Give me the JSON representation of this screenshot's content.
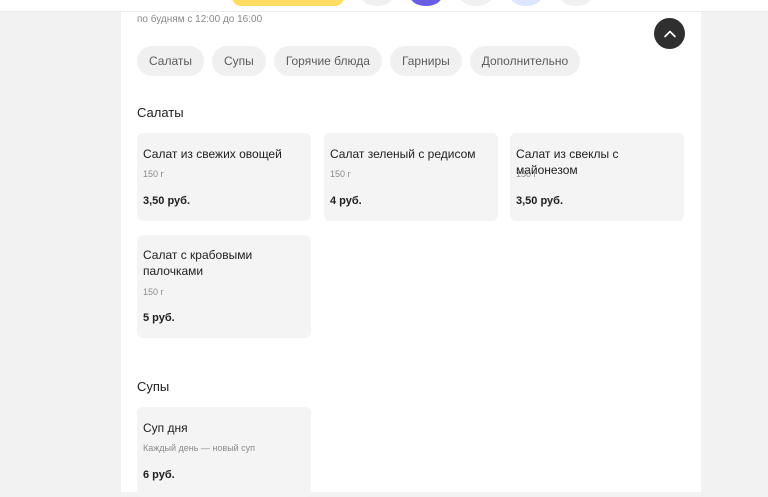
{
  "header": {
    "accent_color": "#ffdd60"
  },
  "hours": "по будням с 12:00 до 16:00",
  "tabs": [
    "Салаты",
    "Супы",
    "Горячие блюда",
    "Гарниры",
    "Дополнительно"
  ],
  "sections": [
    {
      "title": "Салаты",
      "items": [
        {
          "name": "Салат из свежих овощей",
          "weight": "150 г",
          "price": "3,50 руб."
        },
        {
          "name": "Салат зеленый с редисом",
          "weight": "150 г",
          "price": "4 руб."
        },
        {
          "name": "Салат из свеклы с майонезом",
          "weight": "150 г",
          "price": "3,50 руб."
        },
        {
          "name": "Салат с крабовыми палочками",
          "weight": "150 г",
          "price": "5 руб."
        }
      ]
    },
    {
      "title": "Супы",
      "items": [
        {
          "name": "Суп дня",
          "weight": "Каждый день — новый суп",
          "price": "6 руб."
        }
      ]
    }
  ],
  "icons": {
    "scroll_top": "chevron-up-icon"
  }
}
